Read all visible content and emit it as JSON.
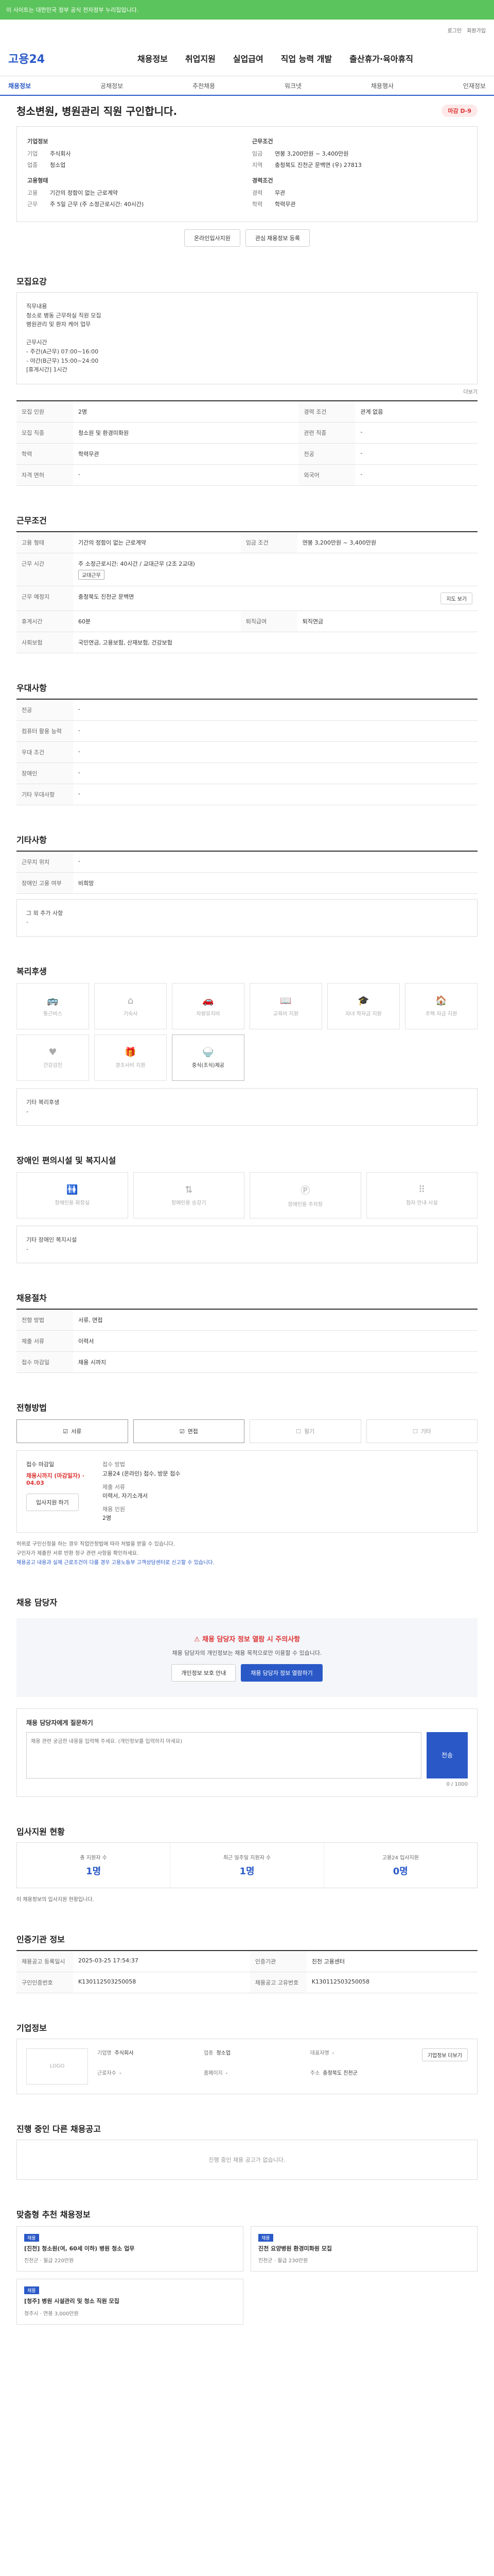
{
  "banner": {
    "text": "이 사이트는 대한민국 정부 공식 전자정부 누리집입니다."
  },
  "topbar": {
    "links": [
      "로그인",
      "회원가입"
    ]
  },
  "header": {
    "logo": "고용24",
    "nav": [
      "채용정보",
      "취업지원",
      "실업급여",
      "직업 능력 개발",
      "출산휴가·육아휴직"
    ]
  },
  "subnav": {
    "items": [
      "채용정보",
      "공채정보",
      "추천채용",
      "워크넷",
      "채용행사",
      "인재정보"
    ],
    "active": 0
  },
  "posting": {
    "title": "청소변원, 병원관리 직원 구인합니다.",
    "status_badge": "마감 D-9",
    "company_section": "기업정보",
    "company_name_label": "기업",
    "company_name": "주식회사",
    "company_type_label": "업종",
    "company_type": "청소업",
    "cond_section": "근무조건",
    "wage_label": "임금",
    "wage": "연봉 3,200만원 ~ 3,400만원",
    "location_label": "지역",
    "location": "충청북도 진천군 문백면 (우) 27813",
    "type_section": "고용형태",
    "employ_label": "고용",
    "employ": "기간의 정함이 없는 근로계약",
    "hours_label": "근무",
    "hours": "주 5일 근무 (주 소정근로시간: 40시간)",
    "career_section": "경력조건",
    "career_label": "경력",
    "career": "무관",
    "edu_label": "학력",
    "edu": "학력무관",
    "apply_btn": "온라인입사지원",
    "scrap_btn": "관심 채용정보 등록"
  },
  "recruit": {
    "title": "모집요강",
    "body": "직무내용\n청소로 병동 근무하실 직원 모집\n병원관리 및 환자 케어 업무\n\n근무시간\n - 주간(A근무) 07:00~16:00\n - 야간(B근무) 15:00~24:00\n[휴게시간] 1시간",
    "more": "더보기",
    "rows": [
      {
        "k": "모집 인원",
        "v": "2명"
      },
      {
        "k": "경력 조건",
        "v": "관계 없음"
      },
      {
        "k": "모집 직종",
        "v": "청소원 및 환경미화원"
      },
      {
        "k": "관련 직종",
        "v": "-"
      },
      {
        "k": "학력",
        "v": "학력무관"
      },
      {
        "k": "전공",
        "v": "-"
      },
      {
        "k": "자격 면허",
        "v": "-"
      },
      {
        "k": "외국어",
        "v": "-"
      }
    ]
  },
  "conditions": {
    "title": "근무조건",
    "rows": [
      {
        "k": "고용 형태",
        "v": "기간의 정함이 없는 근로계약"
      },
      {
        "k": "임금 조건",
        "v": "연봉 3,200만원 ~ 3,400만원"
      },
      {
        "k": "근무 시간",
        "v": "주 소정근로시간: 40시간 / 교대근무 (2조 2교대)"
      },
      {
        "k": "근무 예정지",
        "v": "충청북도 진천군 문백면"
      },
      {
        "k": "휴게시간",
        "v": "60분"
      },
      {
        "k": "사회보험",
        "v": "국민연금, 고용보험, 산재보험, 건강보험"
      },
      {
        "k": "퇴직급여",
        "v": "퇴직연금"
      }
    ],
    "tag": "교대근무",
    "map_btn": "지도 보기"
  },
  "prefer": {
    "title": "우대사항",
    "rows": [
      {
        "k": "전공",
        "v": "-"
      },
      {
        "k": "컴퓨터 활용 능력",
        "v": "-"
      },
      {
        "k": "우대 조건",
        "v": "-"
      },
      {
        "k": "장애인",
        "v": "-"
      },
      {
        "k": "기타 우대사항",
        "v": "-"
      }
    ]
  },
  "etc": {
    "title": "기타사항",
    "rows": [
      {
        "k": "근무지 위치",
        "v": "-"
      },
      {
        "k": "장애인 고용 여부",
        "v": "비희망"
      },
      {
        "k": "그 외 추가 사항",
        "v": "-"
      }
    ]
  },
  "welfare": {
    "title": "복리후생",
    "items": [
      {
        "name": "통근버스",
        "icon": "bus-icon",
        "on": false
      },
      {
        "name": "기숙사",
        "icon": "home-icon",
        "on": false
      },
      {
        "name": "차량유지비",
        "icon": "car-icon",
        "on": false
      },
      {
        "name": "교육비 지원",
        "icon": "book-icon",
        "on": false
      },
      {
        "name": "자녀 학자금 지원",
        "icon": "graduation-icon",
        "on": false
      },
      {
        "name": "주택 자금 지원",
        "icon": "house-icon",
        "on": false
      },
      {
        "name": "건강검진",
        "icon": "heart-icon",
        "on": false
      },
      {
        "name": "경조사비 지원",
        "icon": "gift-icon",
        "on": false
      },
      {
        "name": "중식(조식)제공",
        "icon": "meal-icon",
        "on": true
      }
    ],
    "other_title": "기타 복리후생",
    "other": "-"
  },
  "disability": {
    "title": "장애인 편의시설 및 복지시설",
    "items": [
      {
        "name": "장애인용 화장실",
        "icon": "toilet-icon"
      },
      {
        "name": "장애인용 승강기",
        "icon": "elevator-icon"
      },
      {
        "name": "장애인용 주차장",
        "icon": "parking-icon"
      },
      {
        "name": "점자 안내 시설",
        "icon": "braille-icon"
      }
    ],
    "other_title": "기타 장애인 복지시설",
    "other": "-"
  },
  "selection": {
    "title": "채용절차",
    "rows": [
      {
        "k": "전형 방법",
        "v": "서류, 면접"
      },
      {
        "k": "제출 서류",
        "v": "이력서"
      },
      {
        "k": "접수 마감일",
        "v": "채용 시까지"
      }
    ]
  },
  "method": {
    "title": "전형방법",
    "items": [
      {
        "name": "서류",
        "on": true
      },
      {
        "name": "면접",
        "on": true
      },
      {
        "name": "필기",
        "on": false
      },
      {
        "name": "기타",
        "on": false
      }
    ]
  },
  "apply": {
    "deadline_label": "접수 마감일",
    "deadline": "채용시까지 (마감일자) · 04.03",
    "method_label": "접수 방법",
    "method": "고용24 (온라인) 접수, 방문 접수",
    "docs_label": "제출 서류",
    "docs": "이력서, 자기소개서",
    "count_label": "채용 인원",
    "count": "2명",
    "online_btn": "입사지원 하기"
  },
  "notes": [
    "허위로 구인신청을 하는 경우 직업안정법에 따라 처벌을 받을 수 있습니다.",
    "구인자가 제출한 서류 반환 청구 관련 사항을 확인하세요.",
    "채용공고 내용과 실제 근로조건이 다를 경우 고용노동부 고객상담센터로 신고할 수 있습니다."
  ],
  "contact": {
    "title": "채용 담당자",
    "warn": "채용 담당자 정보 열람 시 주의사항",
    "desc": "채용 담당자의 개인정보는 채용 목적으로만 이용할 수 있습니다.",
    "btn1": "개인정보 보호 안내",
    "btn2": "채용 담당자 정보 열람하기"
  },
  "inquiry": {
    "title": "채용 담당자에게 질문하기",
    "placeholder": "채용 관련 궁금한 내용을 입력해 주세요. (개인정보를 입력하지 마세요)",
    "send": "전송",
    "counter": "0 / 1000"
  },
  "applicants": {
    "title": "입사지원 현황",
    "items": [
      {
        "label": "총 지원자 수",
        "value": "1명"
      },
      {
        "label": "최근 일주일 지원자 수",
        "value": "1명"
      },
      {
        "label": "고용24 입사지원",
        "value": "0명"
      }
    ],
    "note": "이 채용정보의 입사지원 현황입니다."
  },
  "info": {
    "title": "인증기관 정보",
    "rows": [
      {
        "k": "채용공고 등록일시",
        "v": "2025-03-25 17:54:37"
      },
      {
        "k": "인증기관",
        "v": "진천 고용센터"
      },
      {
        "k": "구인인증번호",
        "v": "K130112503250058"
      },
      {
        "k": "채용공고 고유번호",
        "v": "K130112503250058"
      }
    ]
  },
  "company": {
    "title": "기업정보",
    "logo_alt": "LOGO",
    "fields": [
      {
        "k": "기업명",
        "v": "주식회사"
      },
      {
        "k": "업종",
        "v": "청소업"
      },
      {
        "k": "대표자명",
        "v": "-"
      },
      {
        "k": "근로자수",
        "v": "-"
      },
      {
        "k": "홈페이지",
        "v": "-"
      },
      {
        "k": "주소",
        "v": "충청북도 진천군"
      }
    ],
    "btn": "기업정보 더보기"
  },
  "similar": {
    "title": "진행 중인 다른 채용공고",
    "empty": "진행 중인 채용 공고가 없습니다."
  },
  "recommend": {
    "title": "맞춤형 추천 채용정보",
    "cards": [
      {
        "cat": "채용",
        "title": "[진천] 청소원(여, 60세 이하) 병원 청소 업무",
        "meta": "진천군 · 월급 220만원"
      },
      {
        "cat": "채용",
        "title": "진천 요양병원 환경미화원 모집",
        "meta": "진천군 · 월급 230만원"
      },
      {
        "cat": "채용",
        "title": "[청주] 병원 시설관리 및 청소 직원 모집",
        "meta": "청주시 · 연봉 3,000만원"
      }
    ]
  }
}
